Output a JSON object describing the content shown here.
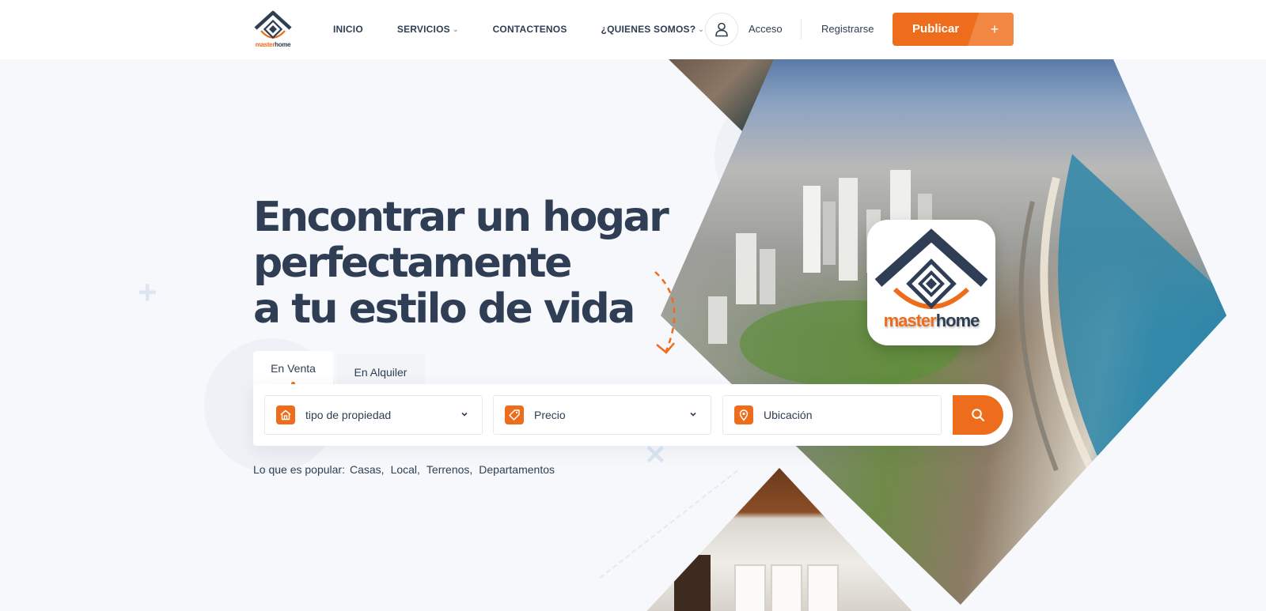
{
  "brand": {
    "logo_text_part1": "master",
    "logo_text_part2": "home"
  },
  "nav": {
    "items": [
      {
        "label": "INICIO",
        "has_dropdown": false
      },
      {
        "label": "SERVICIOS",
        "has_dropdown": true
      },
      {
        "label": "CONTACTENOS",
        "has_dropdown": false
      },
      {
        "label": "¿QUIENES SOMOS?",
        "has_dropdown": true
      }
    ],
    "login_label": "Acceso",
    "register_label": "Registrarse",
    "publish_label": "Publicar",
    "publish_plus": "+"
  },
  "hero": {
    "line1": "Encontrar un hogar",
    "line2": "perfectamente",
    "line3": "a tu estilo de vida"
  },
  "tabs": [
    {
      "label": "En Venta",
      "active": true
    },
    {
      "label": "En Alquiler",
      "active": false
    }
  ],
  "search": {
    "property_type_label": "tipo de propiedad",
    "price_label": "Precio",
    "location_label": "Ubicación"
  },
  "popular": {
    "label": "Lo que es popular:",
    "items": [
      "Casas",
      "Local",
      "Terrenos",
      "Departamentos"
    ]
  },
  "colors": {
    "accent": "#ed6d1c",
    "navy": "#2f3e54",
    "background": "#f7f8fb"
  }
}
